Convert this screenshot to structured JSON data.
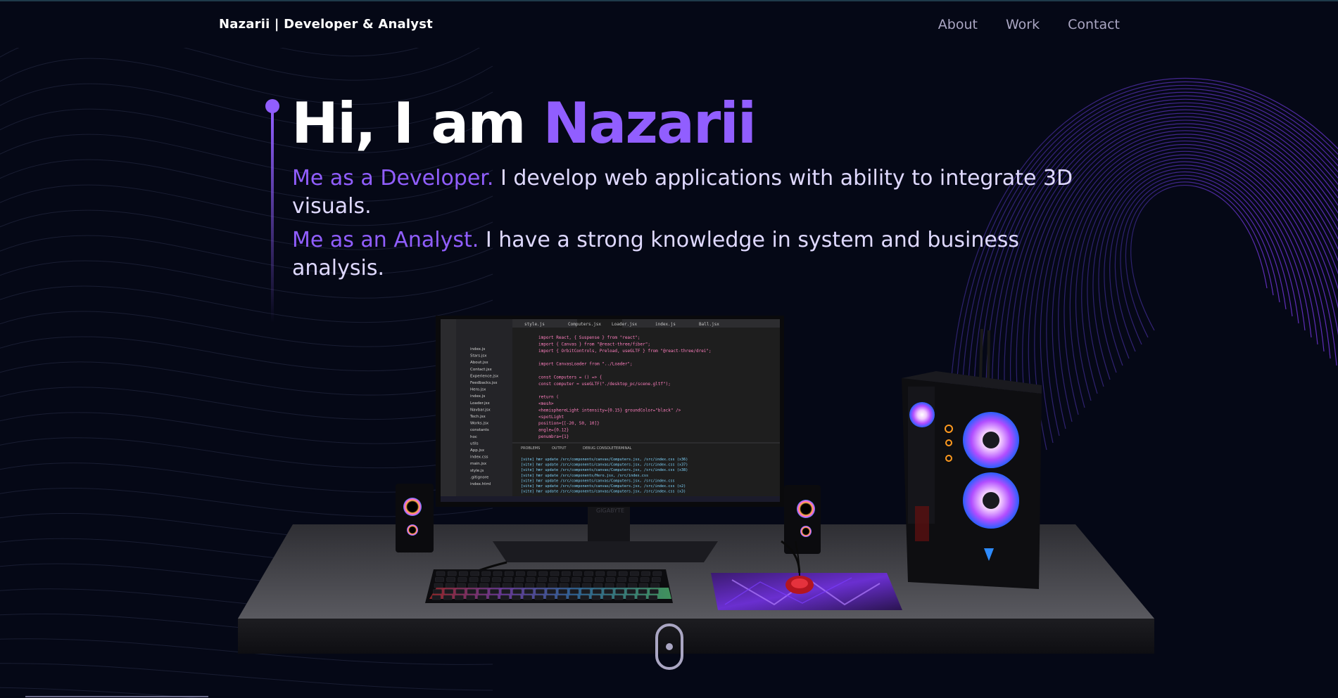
{
  "nav": {
    "brand_name": "Nazarii",
    "brand_tagline": "Developer & Analyst",
    "links": [
      {
        "label": "About"
      },
      {
        "label": "Work"
      },
      {
        "label": "Contact"
      }
    ]
  },
  "hero": {
    "greeting": "Hi, I am ",
    "name": "Nazarii",
    "developer_highlight": "Me as a Developer.",
    "developer_text": " I develop web applications with ability to integrate 3D visuals.",
    "analyst_highlight": "Me as an Analyst.",
    "analyst_text": " I have a strong knowledge in system and business analysis."
  },
  "scene": {
    "monitor_brand": "GIGABYTE",
    "editor_tabs": [
      "style.js",
      "Computers.jsx",
      "Loader.jsx",
      "index.js",
      "Ball.jsx"
    ],
    "explorer_files": [
      "index.js",
      "Stars.jsx",
      "About.jsx",
      "Contact.jsx",
      "Experience.jsx",
      "Feedbacks.jsx",
      "Hero.jsx",
      "index.js",
      "Loader.jsx",
      "Navbar.jsx",
      "Tech.jsx",
      "Works.jsx",
      "constants",
      "hoc",
      "utils",
      "App.jsx",
      "index.css",
      "main.jsx",
      "style.js",
      ".gitignore",
      "index.html"
    ],
    "code_lines": [
      "import React, { Suspense } from \"react\";",
      "import { Canvas } from \"@react-three/fiber\";",
      "import { OrbitControls, Preload, useGLTF } from \"@react-three/drei\";",
      "",
      "import CanvasLoader from \"../Loader\";",
      "",
      "const Computers = () => {",
      "  const computer = useGLTF(\"./desktop_pc/scene.gltf\");",
      "",
      "  return (",
      "    <mesh>",
      "      <hemisphereLight intensity={0.15} groundColor=\"black\" />",
      "      <spotLight",
      "        position={[-20, 50, 10]}",
      "        angle={0.12}",
      "        penumbra={1}"
    ],
    "terminal_lines": [
      "[vite] hmr update /src/components/canvas/Computers.jsx, /src/index.css (x36)",
      "[vite] hmr update /src/components/canvas/Computers.jsx, /src/index.css (x37)",
      "[vite] hmr update /src/components/canvas/Computers.jsx, /src/index.css (x38)",
      "[vite] hmr update /src/components/Hero.jsx, /src/index.css",
      "[vite] hmr update /src/components/canvas/Computers.jsx, /src/index.css",
      "[vite] hmr update /src/components/canvas/Computers.jsx, /src/index.css (x2)",
      "[vite] hmr update /src/components/canvas/Computers.jsx, /src/index.css (x3)"
    ],
    "panel_tabs": [
      "PROBLEMS",
      "OUTPUT",
      "DEBUG CONSOLE",
      "TERMINAL"
    ]
  },
  "colors": {
    "background": "#050816",
    "accent": "#915eff",
    "text_secondary": "#aaa6c3"
  },
  "icons": [
    "scroll-mouse-icon"
  ]
}
